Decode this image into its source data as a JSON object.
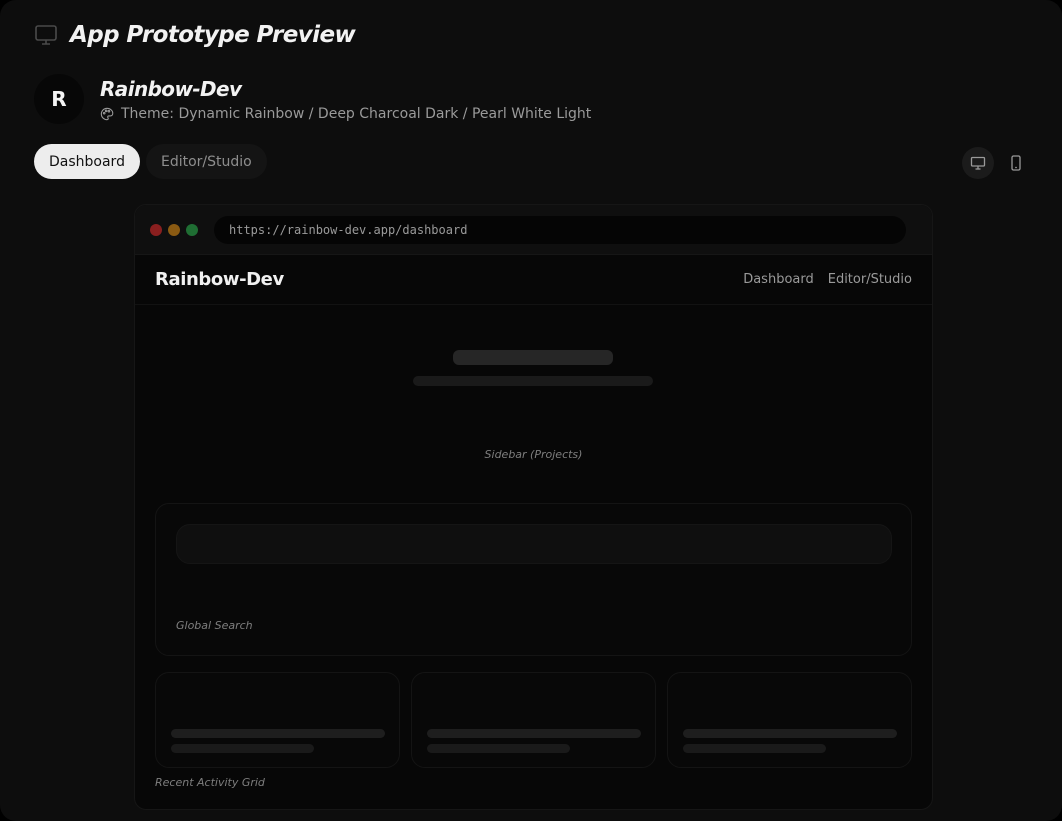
{
  "header": {
    "title": "App Prototype Preview",
    "icon": "monitor-icon"
  },
  "project": {
    "avatar_letter": "R",
    "name": "Rainbow-Dev",
    "theme_text": "Theme: Dynamic Rainbow / Deep Charcoal Dark / Pearl White Light",
    "theme_icon": "palette-icon"
  },
  "tabs": [
    {
      "label": "Dashboard",
      "active": true
    },
    {
      "label": "Editor/Studio",
      "active": false
    }
  ],
  "device_toggle": [
    {
      "icon": "desktop-icon",
      "active": true
    },
    {
      "icon": "mobile-icon",
      "active": false
    }
  ],
  "browser": {
    "url": "https://rainbow-dev.app/dashboard",
    "brand": "Rainbow-Dev",
    "nav_links": [
      "Dashboard",
      "Editor/Studio"
    ]
  },
  "preview": {
    "sidebar_label": "Sidebar (Projects)",
    "search_label": "Global Search",
    "activity_label": "Recent Activity Grid"
  },
  "colors": {
    "background": "#0d0d0d",
    "active_tab": "#ededed",
    "traffic_red": "#8a1f1f",
    "traffic_yellow": "#8a5a12",
    "traffic_green": "#1f6e33"
  }
}
